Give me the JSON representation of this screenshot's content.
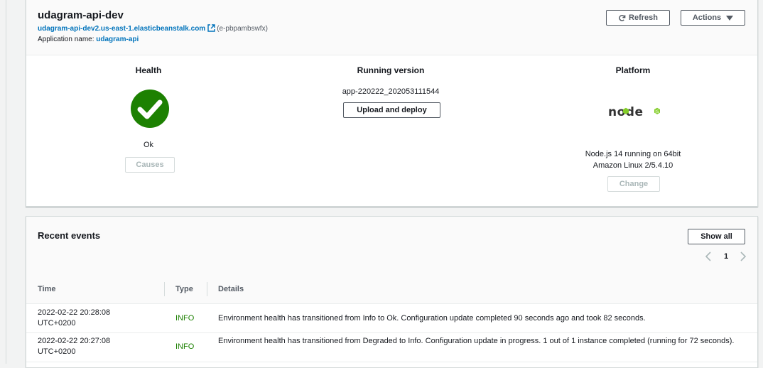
{
  "environment": {
    "name": "udagram-api-dev",
    "url": "udagram-api-dev2.us-east-1.elasticbeanstalk.com",
    "env_id": "(e-pbpambswfx)",
    "app_label": "Application name:",
    "app_name": "udagram-api",
    "refresh_label": "Refresh",
    "actions_label": "Actions"
  },
  "health": {
    "title": "Health",
    "status": "Ok",
    "causes_label": "Causes",
    "status_color": "#1d8102"
  },
  "running_version": {
    "title": "Running version",
    "version": "app-220222_202053111544",
    "upload_label": "Upload and deploy"
  },
  "platform": {
    "title": "Platform",
    "logo_text": "node",
    "line1": "Node.js 14 running on 64bit",
    "line2": "Amazon Linux 2/5.4.10",
    "change_label": "Change"
  },
  "events": {
    "title": "Recent events",
    "show_all_label": "Show all",
    "page": "1",
    "columns": [
      "Time",
      "Type",
      "Details"
    ],
    "rows": [
      {
        "time_line1": "2022-02-22 20:28:08",
        "time_line2": "UTC+0200",
        "type": "INFO",
        "details": "Environment health has transitioned from Info to Ok. Configuration update completed 90 seconds ago and took 82 seconds."
      },
      {
        "time_line1": "2022-02-22 20:27:08",
        "time_line2": "UTC+0200",
        "type": "INFO",
        "details": "Environment health has transitioned from Degraded to Info. Configuration update in progress. 1 out of 1 instance completed (running for 72 seconds)."
      }
    ]
  }
}
